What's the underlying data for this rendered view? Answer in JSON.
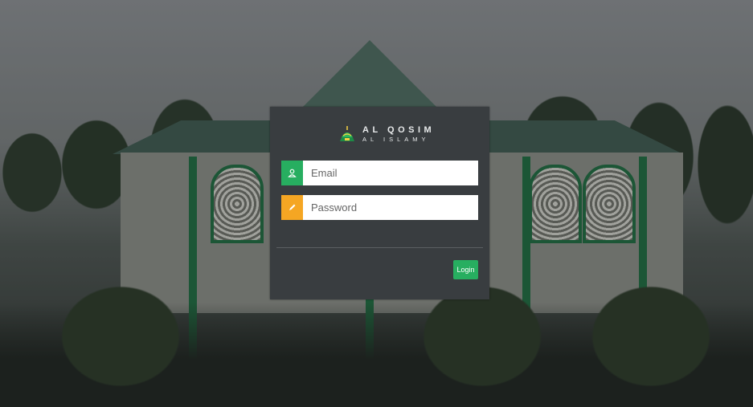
{
  "brand": {
    "line1": "AL QOSIM",
    "line2": "AL ISLAMY",
    "logo_icon": "mosque-dome-logo"
  },
  "form": {
    "email": {
      "placeholder": "Email",
      "value": "",
      "icon": "user-icon"
    },
    "password": {
      "placeholder": "Password",
      "value": "",
      "icon": "pencil-icon"
    },
    "login_label": "Login"
  },
  "colors": {
    "panel": "#393d40",
    "email_addon": "#27ae60",
    "password_addon": "#f5a623",
    "login_button": "#27ae60"
  }
}
